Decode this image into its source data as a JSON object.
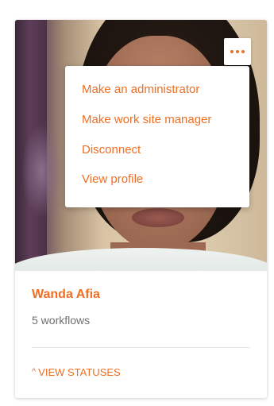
{
  "user": {
    "name": "Wanda Afia",
    "workflows": "5 workflows"
  },
  "menu": {
    "items": [
      {
        "label": "Make an administrator"
      },
      {
        "label": "Make work site manager"
      },
      {
        "label": "Disconnect"
      },
      {
        "label": "View profile"
      }
    ]
  },
  "statuses": {
    "label": "VIEW STATUSES",
    "caret": "^"
  },
  "colors": {
    "accent": "#ee6f24",
    "muted_text": "#6f6f6f",
    "divider": "#e4e4e4"
  },
  "icons": {
    "more": "more-horizontal-icon",
    "caret": "caret-up-icon"
  }
}
